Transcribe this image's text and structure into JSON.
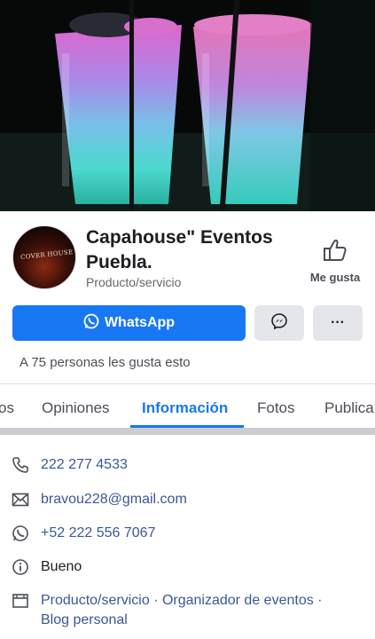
{
  "page": {
    "name": "Capahouse\" Eventos Puebla.",
    "category": "Producto/servicio",
    "avatar_logo_text": "COVER HOUSE",
    "like_label": "Me gusta",
    "whatsapp_label": "WhatsApp",
    "more_label": "···",
    "likes_text": "A 75 personas les gusta esto"
  },
  "tabs": [
    {
      "label": "os",
      "active": false
    },
    {
      "label": "Opiniones",
      "active": false
    },
    {
      "label": "Información",
      "active": true
    },
    {
      "label": "Fotos",
      "active": false
    },
    {
      "label": "Publica",
      "active": false
    }
  ],
  "info": {
    "phone": "222 277 4533",
    "email": "bravou228@gmail.com",
    "whatsapp": "+52 222 556 7067",
    "rating": "Bueno",
    "categories_line1": "Producto/servicio · Organizador de eventos ·",
    "categories_line2": "Blog personal"
  },
  "colors": {
    "accent": "#1877f2",
    "link": "#385898",
    "secondary_button": "#e4e6eb"
  },
  "icons": [
    "phone-icon",
    "envelope-icon",
    "whatsapp-icon",
    "info-icon",
    "category-icon",
    "thumbs-up-icon",
    "messenger-icon"
  ]
}
